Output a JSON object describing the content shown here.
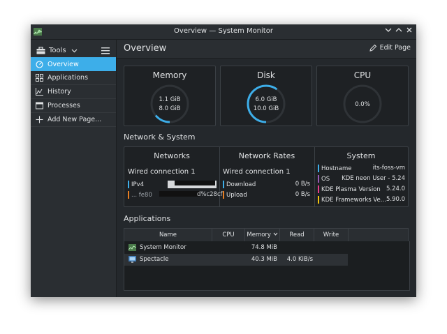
{
  "window": {
    "title": "Overview — System Monitor"
  },
  "sidebar": {
    "tools_label": "Tools",
    "items": [
      {
        "label": "Overview",
        "icon": "overview-icon"
      },
      {
        "label": "Applications",
        "icon": "applications-icon"
      },
      {
        "label": "History",
        "icon": "history-icon"
      },
      {
        "label": "Processes",
        "icon": "processes-icon"
      },
      {
        "label": "Add New Page...",
        "icon": "plus-icon"
      }
    ]
  },
  "header": {
    "title": "Overview",
    "edit_label": "Edit Page"
  },
  "cards": {
    "memory": {
      "title": "Memory",
      "used": "1.1 GiB",
      "total": "8.0 GiB",
      "fraction": 0.14
    },
    "disk": {
      "title": "Disk",
      "used": "6.0 GiB",
      "total": "10.0 GiB",
      "fraction": 0.6
    },
    "cpu": {
      "title": "CPU",
      "value": "0.0%",
      "fraction": 0.0
    }
  },
  "network_section": {
    "title": "Network & System",
    "networks": {
      "title": "Networks",
      "connection": "Wired connection 1",
      "ipv4_label": "IPv4",
      "ipv6_prefix": "...  fe80",
      "ipv6_suffix": "d%c28cf"
    },
    "rates": {
      "title": "Network Rates",
      "connection": "Wired connection 1",
      "download_label": "Download",
      "download_value": "0 B/s",
      "upload_label": "Upload",
      "upload_value": "0 B/s"
    },
    "system": {
      "title": "System",
      "rows": [
        {
          "label": "Hostname",
          "value": "its-foss-vm",
          "color": "#3daee9"
        },
        {
          "label": "OS",
          "value": "KDE neon User - 5.24",
          "color": "#9b59b6"
        },
        {
          "label": "KDE Plasma Version",
          "value": "5.24.0",
          "color": "#e93d8c"
        },
        {
          "label": "KDE Frameworks Ve...",
          "value": "5.90.0",
          "color": "#f1c40f"
        }
      ]
    }
  },
  "applications": {
    "title": "Applications",
    "columns": [
      "Name",
      "CPU",
      "Memory",
      "Read",
      "Write"
    ],
    "rows": [
      {
        "name": "System Monitor",
        "cpu": "",
        "memory": "74.8 MiB",
        "read": "",
        "write": ""
      },
      {
        "name": "Spectacle",
        "cpu": "",
        "memory": "40.3 MiB",
        "read": "4.0 KiB/s",
        "write": ""
      }
    ]
  },
  "colors": {
    "accent": "#3daee9",
    "upload": "#e67e22"
  }
}
